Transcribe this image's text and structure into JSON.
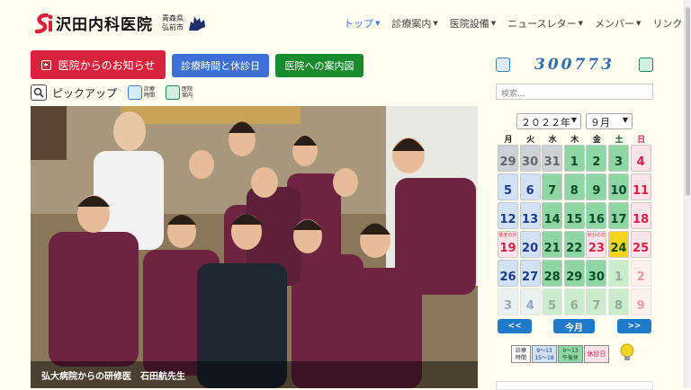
{
  "header": {
    "logo_name": "沢田内科医院",
    "region_line1": "青森県",
    "region_line2": "弘前市",
    "nav": [
      {
        "label": "トップ",
        "active": true,
        "caret": true
      },
      {
        "label": "診療案内",
        "active": false,
        "caret": true
      },
      {
        "label": "医院設備",
        "active": false,
        "caret": true
      },
      {
        "label": "ニュースレター",
        "active": false,
        "caret": true
      },
      {
        "label": "メンバー",
        "active": false,
        "caret": true
      },
      {
        "label": "リンク",
        "active": false,
        "caret": false
      }
    ]
  },
  "buttons": {
    "news": "医院からのお知らせ",
    "hours": "診療時間と休診日",
    "guide": "医院への案内図"
  },
  "pickup": {
    "label": "ピックアップ",
    "icon1_l1": "診療",
    "icon1_l2": "時間",
    "icon2_l1": "医院",
    "icon2_l2": "案内"
  },
  "photo": {
    "caption": "弘大病院からの研修医　石田航先生"
  },
  "sidebar": {
    "counter": "300773",
    "search_placeholder": "検索...",
    "year": "２０２２年",
    "month": "９月",
    "prev": "<<",
    "today": "今月",
    "next": ">>"
  },
  "calendar": {
    "dows": [
      "月",
      "火",
      "水",
      "木",
      "金",
      "土",
      "日"
    ],
    "weeks": [
      [
        {
          "d": "29",
          "c": "gray"
        },
        {
          "d": "30",
          "c": "gray"
        },
        {
          "d": "31",
          "c": "gray"
        },
        {
          "d": "1",
          "c": "green"
        },
        {
          "d": "2",
          "c": "green"
        },
        {
          "d": "3",
          "c": "sat"
        },
        {
          "d": "4",
          "c": "sun"
        }
      ],
      [
        {
          "d": "5",
          "c": "blue"
        },
        {
          "d": "6",
          "c": "blue"
        },
        {
          "d": "7",
          "c": "green"
        },
        {
          "d": "8",
          "c": "green"
        },
        {
          "d": "9",
          "c": "green"
        },
        {
          "d": "10",
          "c": "sat"
        },
        {
          "d": "11",
          "c": "sun"
        }
      ],
      [
        {
          "d": "12",
          "c": "blue"
        },
        {
          "d": "13",
          "c": "blue"
        },
        {
          "d": "14",
          "c": "green"
        },
        {
          "d": "15",
          "c": "green"
        },
        {
          "d": "16",
          "c": "green"
        },
        {
          "d": "17",
          "c": "sat"
        },
        {
          "d": "18",
          "c": "sun"
        }
      ],
      [
        {
          "d": "19",
          "c": "sun",
          "note": "敬老の日"
        },
        {
          "d": "20",
          "c": "blue"
        },
        {
          "d": "21",
          "c": "green"
        },
        {
          "d": "22",
          "c": "green"
        },
        {
          "d": "23",
          "c": "sun",
          "note": "秋分の日"
        },
        {
          "d": "24",
          "c": "today"
        },
        {
          "d": "25",
          "c": "sun"
        }
      ],
      [
        {
          "d": "26",
          "c": "blue"
        },
        {
          "d": "27",
          "c": "blue"
        },
        {
          "d": "28",
          "c": "green"
        },
        {
          "d": "29",
          "c": "green"
        },
        {
          "d": "30",
          "c": "green"
        },
        {
          "d": "1",
          "c": "sat",
          "out": true
        },
        {
          "d": "2",
          "c": "sun",
          "out": true
        }
      ],
      [
        {
          "d": "3",
          "c": "blue",
          "out": true
        },
        {
          "d": "4",
          "c": "blue",
          "out": true
        },
        {
          "d": "5",
          "c": "green",
          "out": true
        },
        {
          "d": "6",
          "c": "green",
          "out": true
        },
        {
          "d": "7",
          "c": "green",
          "out": true
        },
        {
          "d": "8",
          "c": "sat",
          "out": true
        },
        {
          "d": "9",
          "c": "sun",
          "out": true
        }
      ]
    ]
  },
  "legend": {
    "hours_l1": "診療",
    "hours_l2": "時間",
    "morning_l1": "9～13",
    "morning_l2": "15～18",
    "afternoon_l1": "9～13",
    "afternoon_l2": "午後休",
    "closed": "休診日"
  },
  "colors": {
    "accent_red": "#d9233c",
    "accent_blue": "#3d6fd6",
    "accent_green": "#1a8a2f",
    "cal_weekday": "#d0e2f4",
    "cal_open": "#8ed6a4",
    "cal_closed": "#fbe3ea",
    "cal_today": "#f5d51a"
  }
}
